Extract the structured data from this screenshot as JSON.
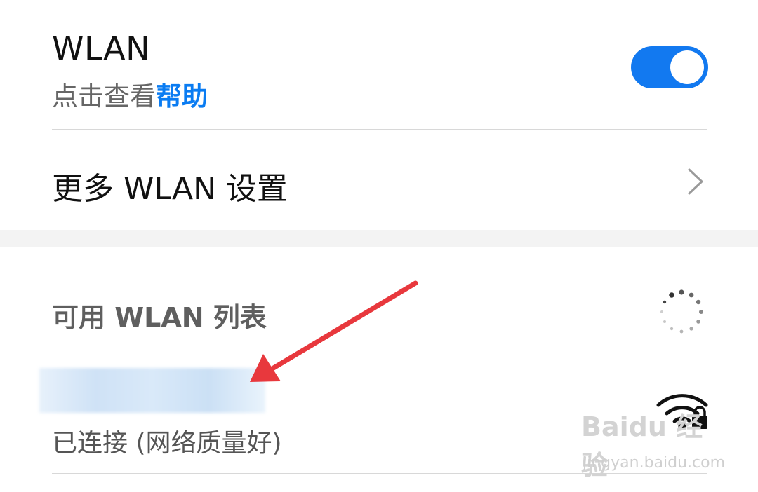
{
  "wlan": {
    "title": "WLAN",
    "subtitle_prefix": "点击查看",
    "subtitle_link": "帮助",
    "toggle_on": true,
    "accent_color": "#1279f0"
  },
  "more": {
    "label": "更多 WLAN 设置",
    "chevron_icon": "chevron-right-icon"
  },
  "available": {
    "header": "可用 WLAN 列表",
    "spinner_icon": "loading-spinner-icon",
    "networks": [
      {
        "ssid": "",
        "status": "已连接 (网络质量好)",
        "signal_icon": "wifi-lock-icon"
      }
    ]
  },
  "watermark": {
    "main": "Baidu 经验",
    "sub": "jingyan.baidu.com"
  }
}
